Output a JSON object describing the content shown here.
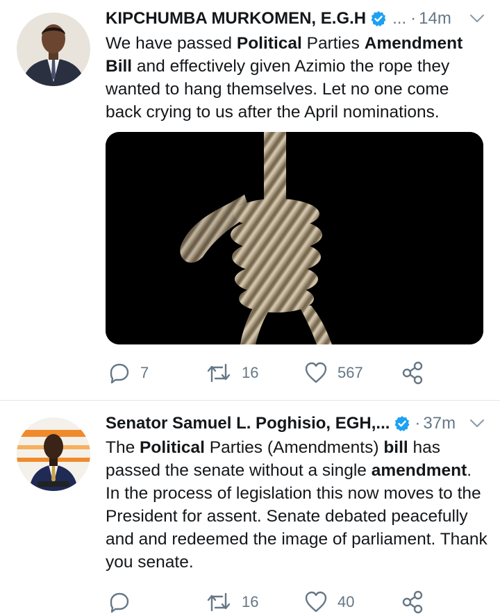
{
  "tweets": [
    {
      "author": "KIPCHUMBA MURKOMEN, E.G.H",
      "handle_truncated": "...",
      "separator": "·",
      "time": "14m",
      "verified": true,
      "text_parts": [
        {
          "t": "We have passed  ",
          "bold": false
        },
        {
          "t": "Political",
          "bold": true
        },
        {
          "t": " Parties ",
          "bold": false
        },
        {
          "t": "Amendment Bill",
          "bold": true
        },
        {
          "t": " and effectively given Azimio the rope they wanted to hang themselves. Let no one come back crying to us after the April nominations.",
          "bold": false
        }
      ],
      "media": "hanging-rope-noose-photo",
      "replies": "7",
      "retweets": "16",
      "likes": "567"
    },
    {
      "author": "Senator Samuel L. Poghisio, EGH,...",
      "separator": "·",
      "time": "37m",
      "verified": true,
      "text_parts": [
        {
          "t": "The ",
          "bold": false
        },
        {
          "t": "Political",
          "bold": true
        },
        {
          "t": " Parties (Amendments) ",
          "bold": false
        },
        {
          "t": "bill",
          "bold": true
        },
        {
          "t": " has passed the senate without a single ",
          "bold": false
        },
        {
          "t": "amendment",
          "bold": true
        },
        {
          "t": ". In the process of legislation this now moves to the President for assent. Senate debated peacefully and and redeemed the image of parliament. Thank you senate.",
          "bold": false
        }
      ],
      "replies": "",
      "retweets": "16",
      "likes": "40"
    }
  ],
  "colors": {
    "verified": "#1da1f2",
    "secondary_text": "#657786",
    "divider": "#e1e8ed"
  }
}
